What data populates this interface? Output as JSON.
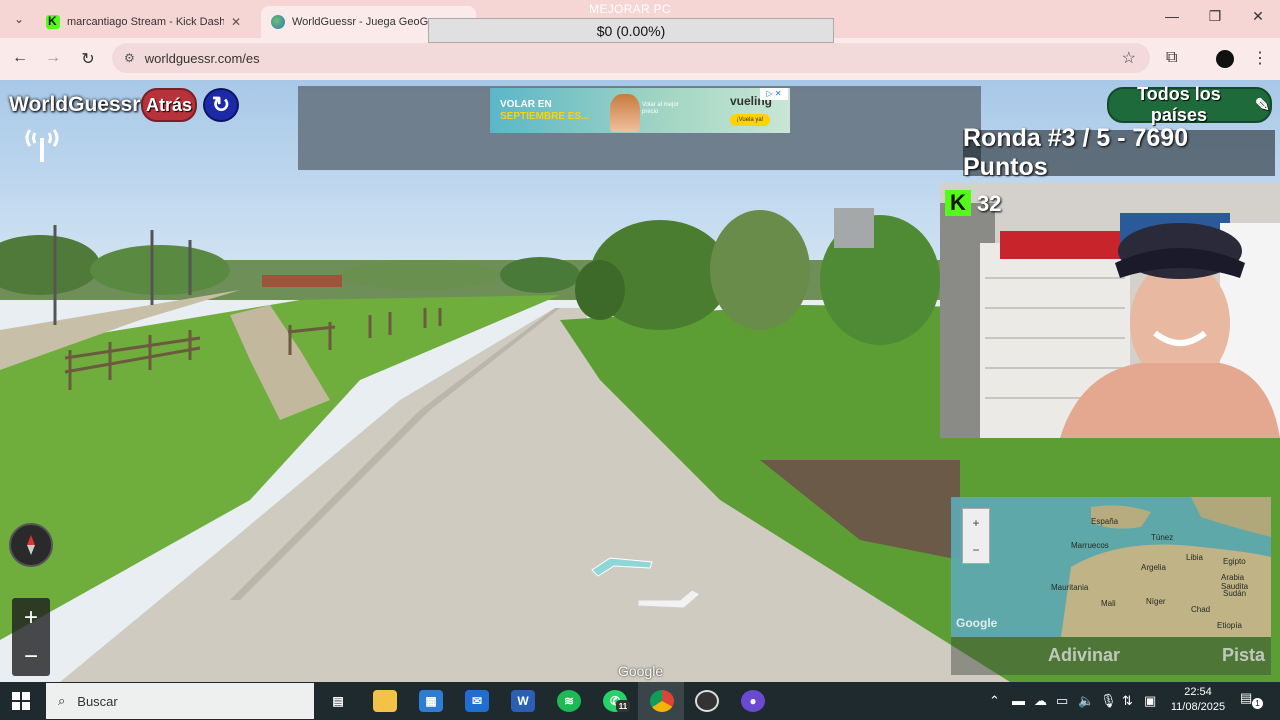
{
  "browser": {
    "tabs": [
      {
        "title": "marcantiago Stream - Kick Dashb",
        "favicon": "kick-icon"
      },
      {
        "title": "WorldGuessr - Juega GeoGuessr",
        "favicon": "globe-icon"
      }
    ],
    "url": "worldguessr.com/es"
  },
  "donation": {
    "title": "MEJORAR PC",
    "amount": "$0 (0.00%)"
  },
  "game": {
    "logo": "WorldGuessr",
    "back_label": "Atrás",
    "countries_label": "Todos los países",
    "round_text": "Ronda #3 / 5 - 7690 Puntos",
    "guess_label": "Adivinar",
    "hint_label": "Pista",
    "google_watermark": "Google"
  },
  "ad": {
    "headline_1": "VOLAR EN",
    "headline_2": "SEPTIEMBRE ES...",
    "small_1": "Volar al mejor",
    "small_2": "precio",
    "brand": "vueling",
    "cta": "¡Vuela ya!"
  },
  "stream": {
    "viewer_count": "32"
  },
  "minimap": {
    "labels": [
      "España",
      "Túnez",
      "Argelia",
      "Libia",
      "Egipto",
      "Mali",
      "Níger",
      "Chad",
      "Sudán",
      "Arabia Saudita",
      "Etiopía",
      "Marruecos",
      "Mauritania"
    ],
    "google": "Google"
  },
  "taskbar": {
    "search_placeholder": "Buscar",
    "time": "22:54",
    "date": "11/08/2025",
    "whatsapp_badge": "11",
    "notifications": "1"
  }
}
